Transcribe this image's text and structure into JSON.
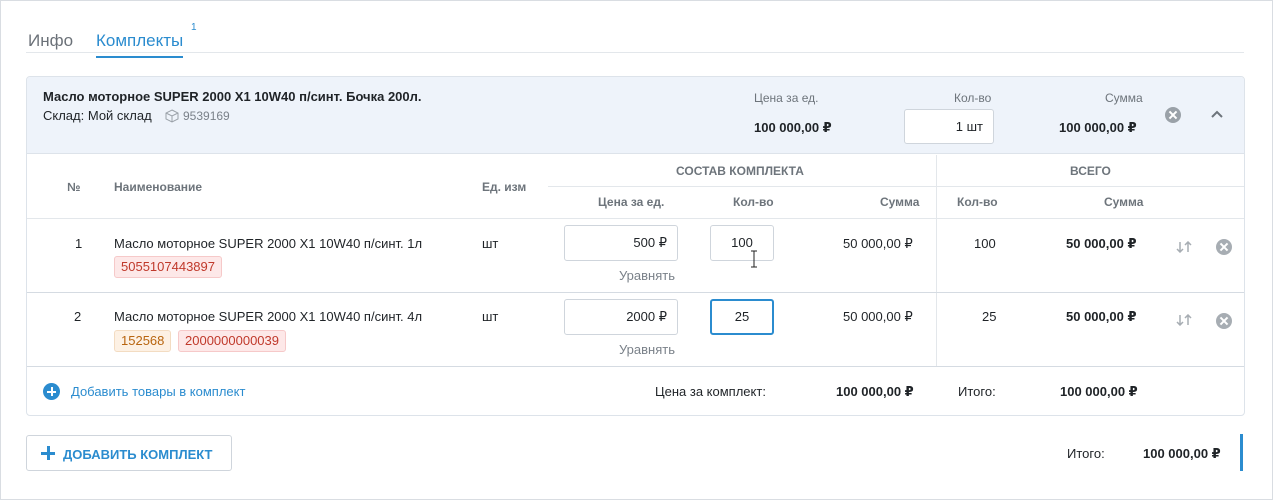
{
  "tabs": [
    {
      "label": "Инфо"
    },
    {
      "label": "Комплекты",
      "badge": "1"
    }
  ],
  "kit": {
    "title": "Масло моторное SUPER 2000 X1 10W40 п/синт. Бочка 200л.",
    "store": "Склад: Мой склад",
    "sku": "9539169",
    "price_label": "Цена за ед.",
    "price": "100 000,00 ₽",
    "qty_label": "Кол-во",
    "qty": "1 шт",
    "sum_label": "Сумма",
    "sum": "100 000,00 ₽"
  },
  "table": {
    "headers": {
      "num": "№",
      "name": "Наименование",
      "unit": "Ед. изм",
      "group_composition": "СОСТАВ КОМПЛЕКТА",
      "group_total": "ВСЕГО",
      "price": "Цена за ед.",
      "qty": "Кол-во",
      "sum": "Сумма",
      "total_qty": "Кол-во",
      "total_sum": "Сумма"
    },
    "rows": [
      {
        "num": "1",
        "name": "Масло моторное SUPER 2000 X1 10W40 п/синт. 1л",
        "codes": [
          "5055107443897"
        ],
        "unit": "шт",
        "price": "500 ₽",
        "equalize": "Уравнять",
        "qty": "100",
        "sum": "50 000,00 ₽",
        "total_qty": "100",
        "total_sum": "50 000,00 ₽"
      },
      {
        "num": "2",
        "name": "Масло моторное SUPER 2000 X1 10W40 п/синт. 4л",
        "codes": [
          "152568",
          "2000000000039"
        ],
        "unit": "шт",
        "price": "2000 ₽",
        "equalize": "Уравнять",
        "qty": "25",
        "sum": "50 000,00 ₽",
        "total_qty": "25",
        "total_sum": "50 000,00 ₽"
      }
    ]
  },
  "footer": {
    "add_goods": "Добавить товары в комплект",
    "kit_price_label": "Цена за комплект:",
    "kit_price": "100 000,00 ₽",
    "total_label": "Итого:",
    "total": "100 000,00 ₽"
  },
  "bottom": {
    "add_kit": "ДОБАВИТЬ КОМПЛЕКТ",
    "grand_label": "Итого:",
    "grand_total": "100 000,00 ₽"
  },
  "colors": {
    "accent": "#2b8ccf",
    "header_bg": "#eef3fa",
    "tag_red": "#c0392b",
    "tag_orange": "#b8650f"
  }
}
